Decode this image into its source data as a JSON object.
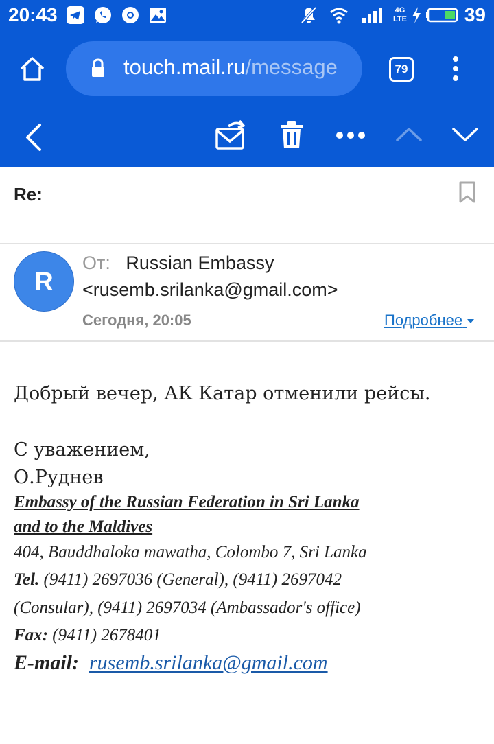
{
  "status_bar": {
    "time": "20:43",
    "battery": "39",
    "network": "4G LTE"
  },
  "browser": {
    "url_domain": "touch.mail.ru",
    "url_path": "/message",
    "tab_count": "79"
  },
  "icons": {
    "home": "home-icon",
    "lock": "lock-icon",
    "menu": "more-vertical-icon",
    "back": "chevron-left-icon",
    "mark_unread": "mark-unread-icon",
    "delete": "trash-icon",
    "more": "more-horizontal-icon",
    "prev": "chevron-up-icon",
    "next": "chevron-down-icon",
    "bookmark": "bookmark-icon"
  },
  "message": {
    "subject": "Re:",
    "from_label": "От:",
    "from_name": "Russian Embassy",
    "from_email": "<rusemb.srilanka@gmail.com>",
    "avatar_letter": "R",
    "date": "Сегодня, 20:05",
    "details_label": "Подробнее",
    "greeting": "Добрый вечер, АК Катар отменили рейсы.",
    "regards": "С уважением,",
    "signature_name": "О.Руднев",
    "embassy_line1": "Embassy of the Russian Federation in Sri Lanka",
    "embassy_line2": "and to the Maldives",
    "address": "404, Bauddhaloka mawatha, Colombo 7, Sri Lanka",
    "tel_label": "Tel.",
    "tel_line1": " (9411) 2697036 (General), (9411) 2697042",
    "tel_line2": "(Consular), (9411) 2697034 (Ambassador's office)",
    "fax_label": "Fax:",
    "fax_value": " (9411) 2678401",
    "email_label": "E-mail:",
    "email_value": "rusemb.srilanka@gmail.com"
  },
  "colors": {
    "brand_blue": "#0a5ad6",
    "link_blue": "#1a73c9"
  }
}
